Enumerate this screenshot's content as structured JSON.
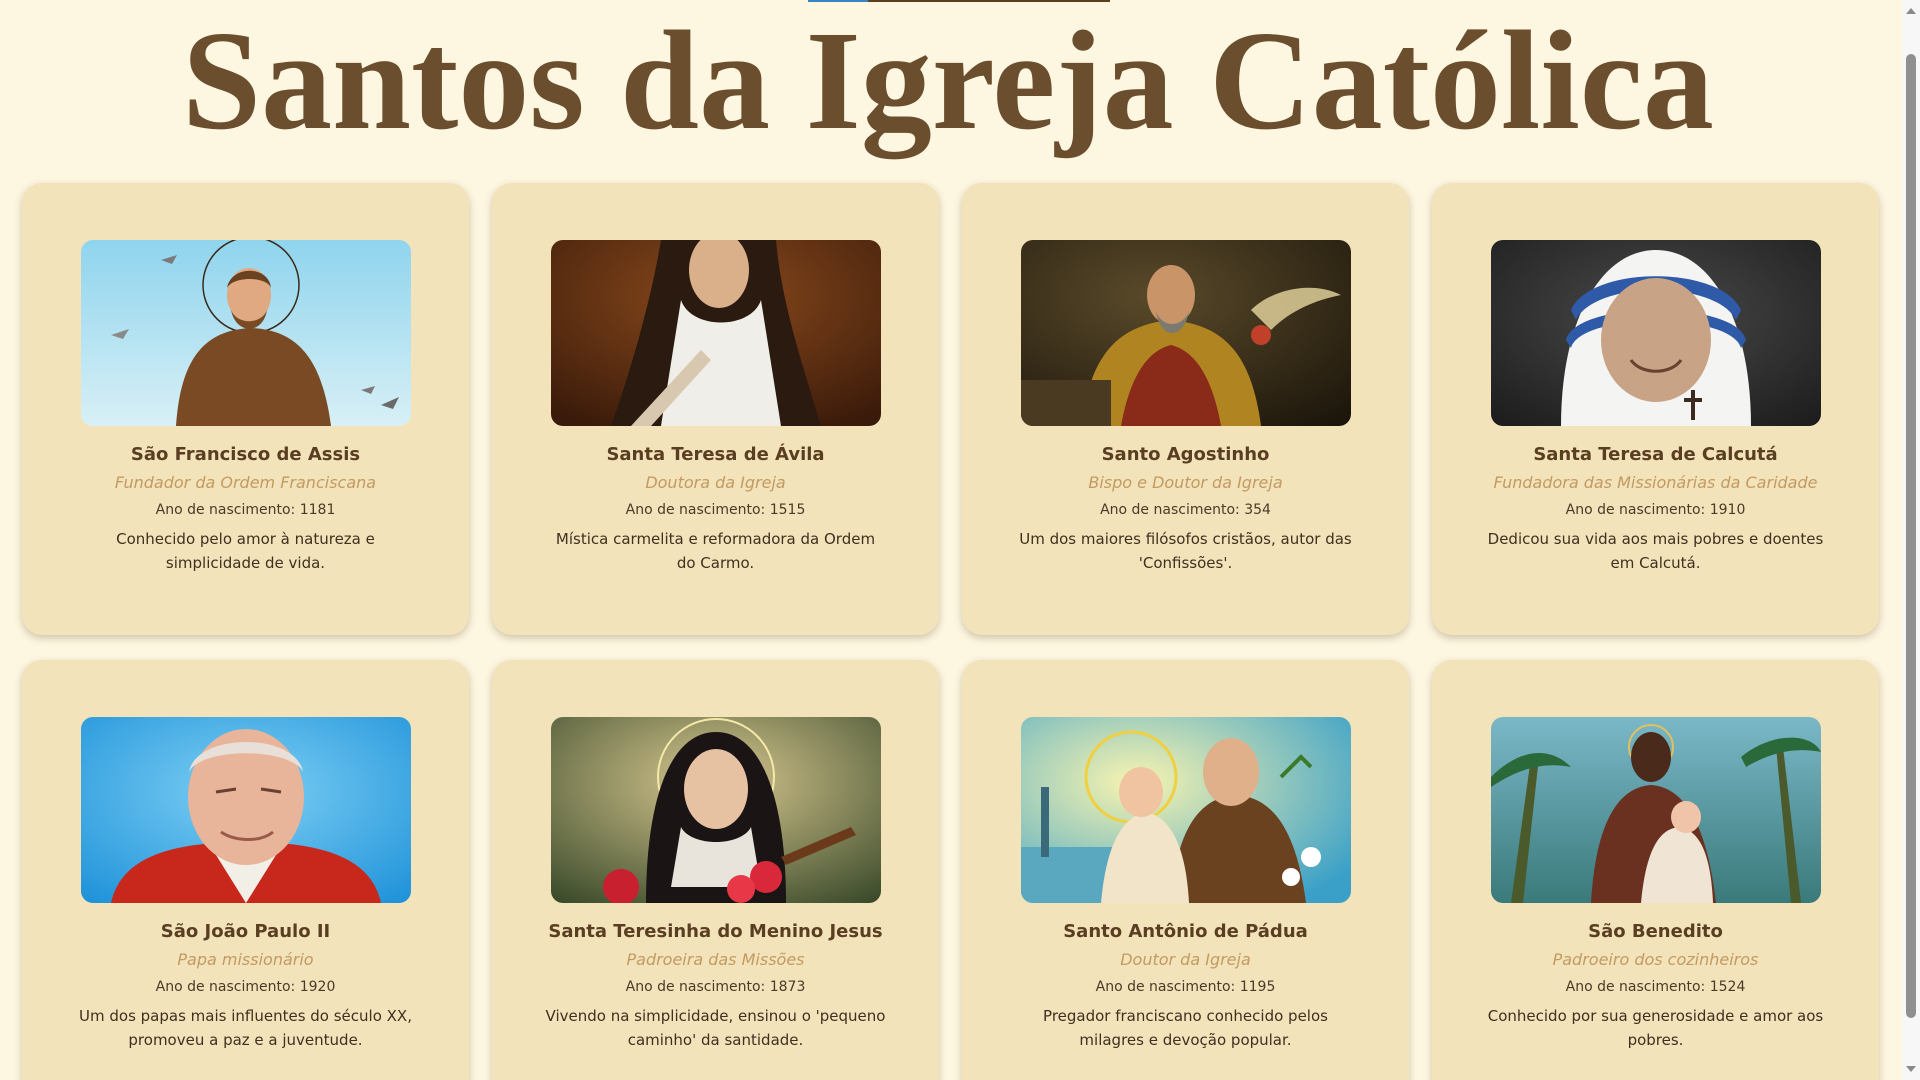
{
  "page": {
    "title": "Santos da Igreja Católica"
  },
  "label_birth": "Ano de nascimento:",
  "saints": [
    {
      "name": "São Francisco de Assis",
      "title": "Fundador da Ordem Franciscana",
      "birth_year": "1181",
      "description": "Conhecido pelo amor à natureza e simplicidade de vida."
    },
    {
      "name": "Santa Teresa de Ávila",
      "title": "Doutora da Igreja",
      "birth_year": "1515",
      "description": "Mística carmelita e reformadora da Ordem do Carmo."
    },
    {
      "name": "Santo Agostinho",
      "title": "Bispo e Doutor da Igreja",
      "birth_year": "354",
      "description": "Um dos maiores filósofos cristãos, autor das 'Confissões'."
    },
    {
      "name": "Santa Teresa de Calcutá",
      "title": "Fundadora das Missionárias da Caridade",
      "birth_year": "1910",
      "description": "Dedicou sua vida aos mais pobres e doentes em Calcutá."
    },
    {
      "name": "São João Paulo II",
      "title": "Papa missionário",
      "birth_year": "1920",
      "description": "Um dos papas mais influentes do século XX, promoveu a paz e a juventude."
    },
    {
      "name": "Santa Teresinha do Menino Jesus",
      "title": "Padroeira das Missões",
      "birth_year": "1873",
      "description": "Vivendo na simplicidade, ensinou o 'pequeno caminho' da santidade."
    },
    {
      "name": "Santo Antônio de Pádua",
      "title": "Doutor da Igreja",
      "birth_year": "1195",
      "description": "Pregador franciscano conhecido pelos milagres e devoção popular."
    },
    {
      "name": "São Benedito",
      "title": "Padroeiro dos cozinheiros",
      "birth_year": "1524",
      "description": "Conhecido por sua generosidade e amor aos pobres."
    }
  ],
  "colors": {
    "background": "#fdf6e0",
    "card": "#f3e3ba",
    "heading": "#6b4e2e",
    "subtitle": "#c39a62"
  }
}
